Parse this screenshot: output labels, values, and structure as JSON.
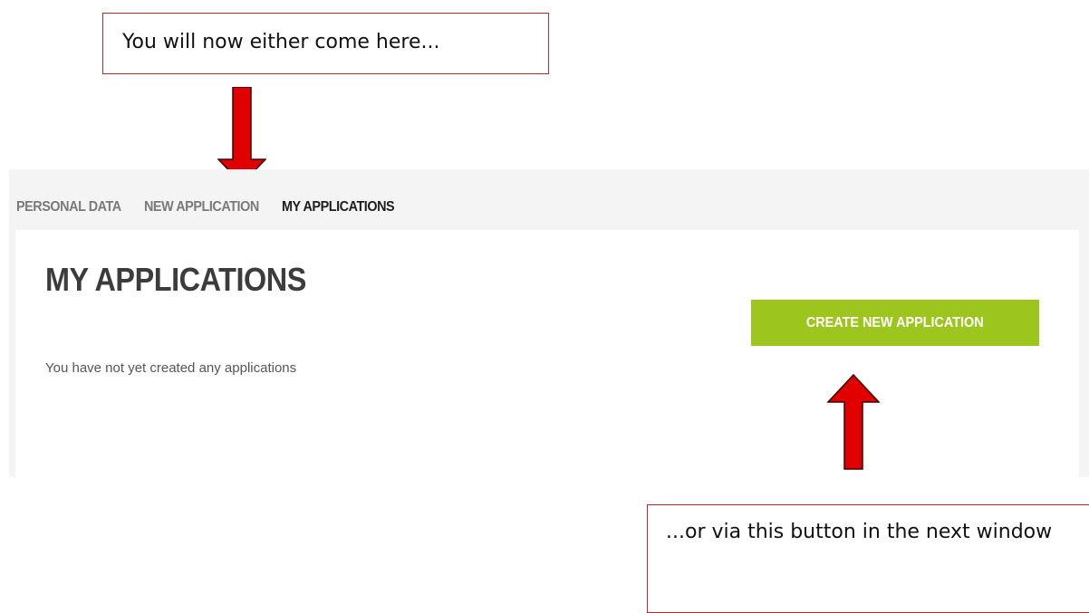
{
  "callouts": {
    "top": "You will now either come here...",
    "bottom": "...or via this button in the next window"
  },
  "nav": {
    "items": [
      {
        "label": "PERSONAL DATA"
      },
      {
        "label": "NEW APPLICATION"
      },
      {
        "label": "MY APPLICATIONS"
      }
    ]
  },
  "main": {
    "title": "MY APPLICATIONS",
    "create_button_label": "CREATE NEW APPLICATION",
    "empty_message": "You have not yet created any applications"
  },
  "colors": {
    "annotation_red": "#e00000",
    "callout_border": "#c0282d",
    "button_green": "#9cc51e",
    "nav_inactive": "#7a7a7a",
    "nav_active": "#1e1e1e"
  }
}
